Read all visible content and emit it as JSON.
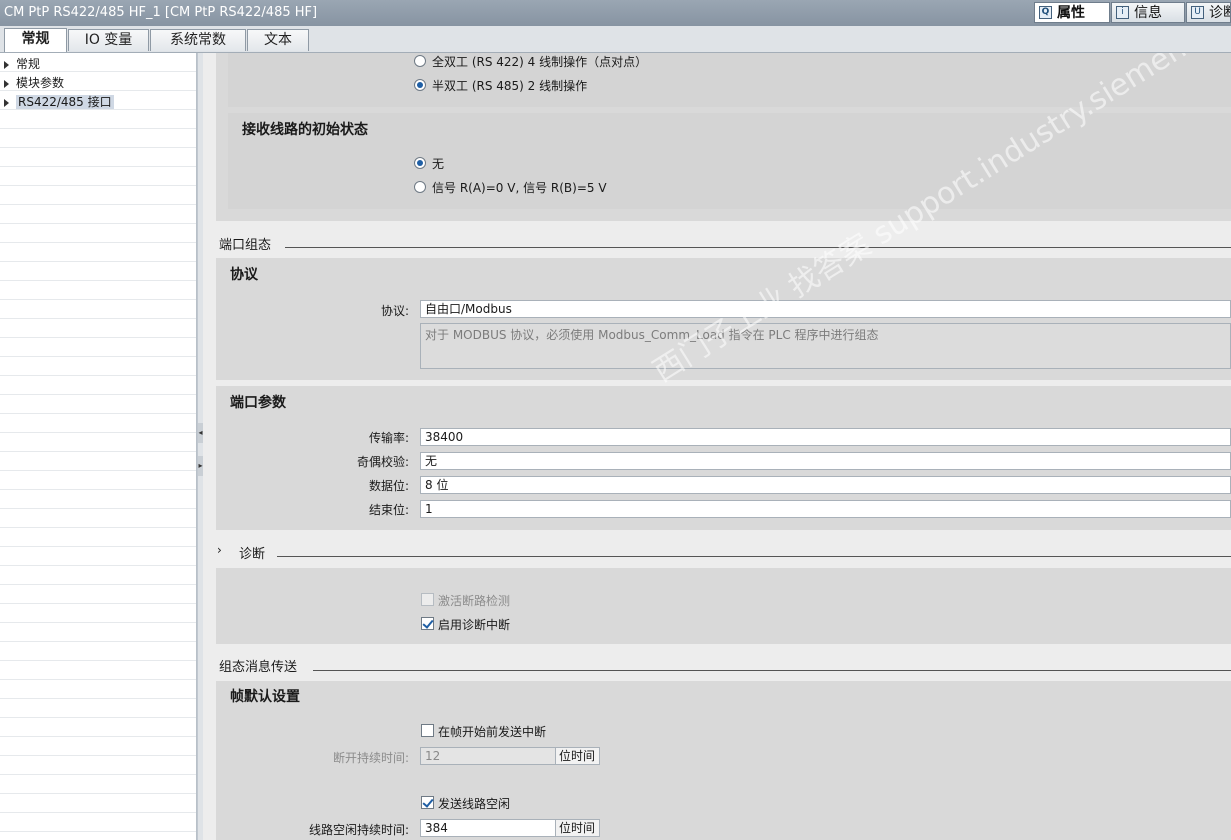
{
  "window": {
    "title": "CM PtP RS422/485 HF_1 [CM PtP RS422/485 HF]"
  },
  "right_tabs": [
    {
      "label": "属性",
      "icon": "properties-icon"
    },
    {
      "label": "信息",
      "icon": "info-icon"
    },
    {
      "label": "诊断",
      "icon": "diagnostics-icon"
    }
  ],
  "tabs": [
    {
      "label": "常规"
    },
    {
      "label": "IO 变量"
    },
    {
      "label": "系统常数"
    },
    {
      "label": "文本"
    }
  ],
  "tree": {
    "items": [
      {
        "label": "常规"
      },
      {
        "label": "模块参数"
      },
      {
        "label": "RS422/485 接口"
      }
    ]
  },
  "operation_mode": {
    "options": [
      {
        "label": "全双工 (RS 422) 4 线制操作（点对点）",
        "selected": false
      },
      {
        "label": "半双工 (RS 485) 2 线制操作",
        "selected": true
      }
    ]
  },
  "receive_line": {
    "title": "接收线路的初始状态",
    "options": [
      {
        "label": "无",
        "selected": true
      },
      {
        "label": "信号 R(A)=0 V, 信号 R(B)=5 V",
        "selected": false
      }
    ]
  },
  "port_config": {
    "heading": "端口组态",
    "protocol_panel": {
      "title": "协议",
      "label": "协议:",
      "value": "自由口/Modbus",
      "note": "对于 MODBUS 协议，必须使用 Modbus_Comm_Load 指令在 PLC 程序中进行组态"
    },
    "params_panel": {
      "title": "端口参数",
      "fields": [
        {
          "label": "传输率:",
          "value": "38400"
        },
        {
          "label": "奇偶校验:",
          "value": "无"
        },
        {
          "label": "数据位:",
          "value": "8 位"
        },
        {
          "label": "结束位:",
          "value": "1"
        }
      ]
    }
  },
  "diagnostics": {
    "heading": "诊断",
    "checkboxes": [
      {
        "label": "激活断路检测",
        "checked": false,
        "enabled": false
      },
      {
        "label": "启用诊断中断",
        "checked": true,
        "enabled": true
      }
    ]
  },
  "message_transfer": {
    "heading": "组态消息传送",
    "panel_title": "帧默认设置",
    "send_break": {
      "label": "在帧开始前发送中断",
      "checked": false
    },
    "break_duration": {
      "label": "断开持续时间:",
      "value": "12",
      "unit": "位时间"
    },
    "send_idle": {
      "label": "发送线路空闲",
      "checked": true
    },
    "idle_duration": {
      "label": "线路空闲持续时间:",
      "value": "384",
      "unit": "位时间"
    }
  },
  "watermark": "西门子工业 找答案 support.industry.siemens.com/cs"
}
